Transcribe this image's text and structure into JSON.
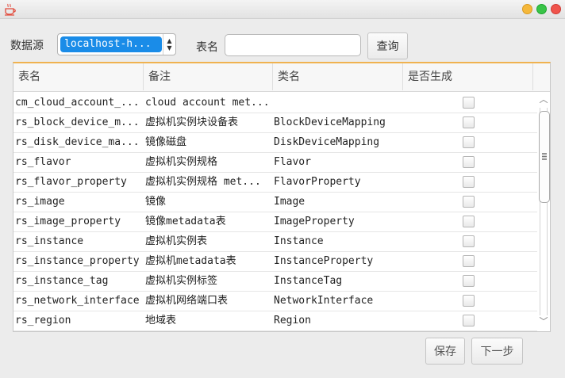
{
  "window": {
    "icon": "coffee-cup-icon"
  },
  "toolbar": {
    "datasource_label": "数据源",
    "datasource_value": "localhost-h...",
    "tablename_label": "表名",
    "tablename_value": "",
    "query_label": "查询"
  },
  "table": {
    "columns": [
      "表名",
      "备注",
      "类名",
      "是否生成"
    ],
    "rows": [
      {
        "name": "cm_cloud_account_...",
        "remark": "cloud account met...",
        "class": "",
        "generate": false
      },
      {
        "name": "rs_block_device_m...",
        "remark": "虚拟机实例块设备表",
        "class": "BlockDeviceMapping",
        "generate": false
      },
      {
        "name": "rs_disk_device_ma...",
        "remark": "镜像磁盘",
        "class": "DiskDeviceMapping",
        "generate": false
      },
      {
        "name": "rs_flavor",
        "remark": "虚拟机实例规格",
        "class": "Flavor",
        "generate": false
      },
      {
        "name": "rs_flavor_property",
        "remark": "虚拟机实例规格 met...",
        "class": "FlavorProperty",
        "generate": false
      },
      {
        "name": "rs_image",
        "remark": "镜像",
        "class": "Image",
        "generate": false
      },
      {
        "name": "rs_image_property",
        "remark": "镜像metadata表",
        "class": "ImageProperty",
        "generate": false
      },
      {
        "name": "rs_instance",
        "remark": "虚拟机实例表",
        "class": "Instance",
        "generate": false
      },
      {
        "name": "rs_instance_property",
        "remark": "虚拟机metadata表",
        "class": "InstanceProperty",
        "generate": false
      },
      {
        "name": "rs_instance_tag",
        "remark": "虚拟机实例标签",
        "class": "InstanceTag",
        "generate": false
      },
      {
        "name": "rs_network_interface",
        "remark": "虚拟机网络端口表",
        "class": "NetworkInterface",
        "generate": false
      },
      {
        "name": "rs_region",
        "remark": "地域表",
        "class": "Region",
        "generate": false
      }
    ]
  },
  "footer": {
    "save_label": "保存",
    "next_label": "下一步"
  },
  "colors": {
    "selection": "#1a8ce8",
    "table_accent": "#f0b250",
    "close": "#f0544c",
    "minimize": "#f5b83b",
    "maximize": "#39c448"
  }
}
